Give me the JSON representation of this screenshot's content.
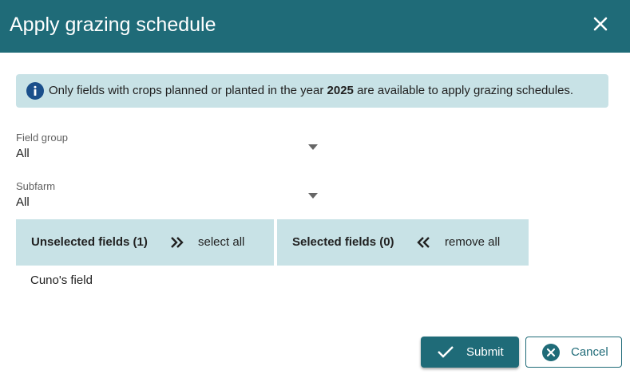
{
  "dialog": {
    "title": "Apply grazing schedule",
    "close_icon": "close-icon"
  },
  "info": {
    "icon": "info-icon",
    "text_before": "Only fields with crops planned or planted in the year ",
    "year": "2025",
    "text_after": " are available to apply grazing schedules."
  },
  "filters": {
    "field_group": {
      "label": "Field group",
      "value": "All"
    },
    "subfarm": {
      "label": "Subfarm",
      "value": "All"
    }
  },
  "unselected": {
    "title": "Unselected fields (1)",
    "action_label": "select all",
    "action_icon": "double-chevron-right-icon",
    "items": [
      "Cuno's field"
    ]
  },
  "selected": {
    "title": "Selected fields (0)",
    "action_label": "remove all",
    "action_icon": "double-chevron-left-icon",
    "items": []
  },
  "buttons": {
    "submit_label": "Submit",
    "submit_icon": "check-icon",
    "cancel_label": "Cancel",
    "cancel_icon": "cancel-circle-icon"
  },
  "colors": {
    "primary": "#1f6b78",
    "panel": "#c8e2e6",
    "info_icon": "#1a4f8b"
  }
}
